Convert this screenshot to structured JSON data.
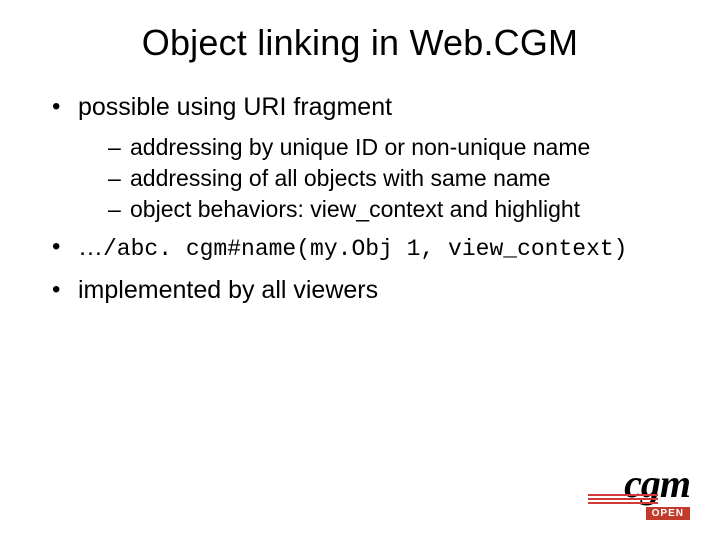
{
  "title": "Object linking in Web.CGM",
  "bullets": {
    "b1": "possible using URI fragment",
    "b1_sub": {
      "s1": "addressing by unique ID or non-unique name",
      "s2": "addressing of all objects with same name",
      "s3": "object behaviors: view_context and highlight"
    },
    "b2_prefix": "…",
    "b2_code": "/abc. cgm#name(my.Obj 1, view_context)",
    "b3": "implemented by all viewers"
  },
  "logo": {
    "main": "cgm",
    "tag": "OPEN"
  }
}
